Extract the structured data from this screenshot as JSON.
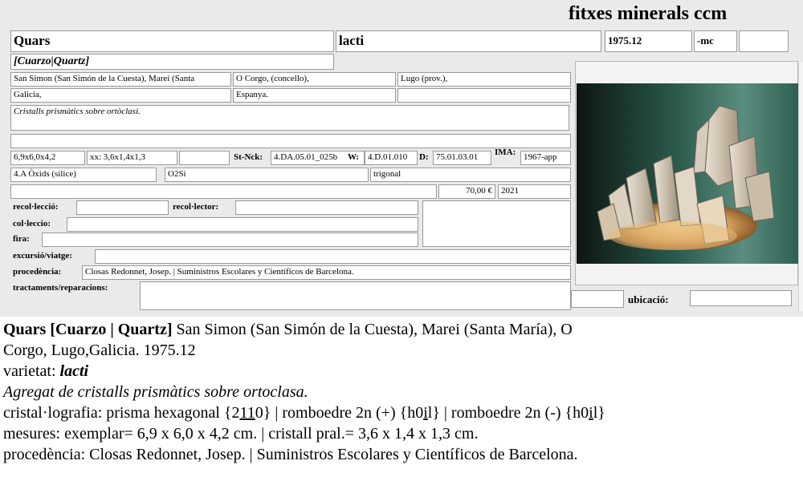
{
  "card": {
    "title": "fitxes minerals ccm",
    "name": "Quars",
    "variety": "lacti",
    "date": "1975.12",
    "suffix": "-mc",
    "synonyms": "[Cuarzo|Quartz]",
    "loc1": "San Simon (San Simón de la Cuesta), Marei (Santa",
    "loc2": "O Corgo, (concello),",
    "loc3": "Lugo (prov.),",
    "loc4": "Galicia,",
    "loc5": "Espanya.",
    "description": "Cristalls prismàtics sobre ortòclasi.",
    "size": "6,9x6,0x4,2",
    "crystal_size": "xx: 3,6x1,4x1,3",
    "stnck_label": "St-Nck:",
    "stnck": "4.DA.05.01_025b",
    "w_label": "W:",
    "w": "4.D.01.010",
    "d_label": "D:",
    "d": "75.01.03.01",
    "ima_label": "IMA:",
    "ima": "1967-app",
    "class": "4.A Òxids (silice)",
    "formula": "O2Si",
    "system": "trigonal",
    "price": "70,00 €",
    "year": "2021",
    "recoleccio_label": "recol·lecció:",
    "recolector_label": "recol·lector:",
    "colleccio_label": "col·leccio:",
    "fira_label": "fira:",
    "excursio_label": "excursió/viatge:",
    "procedencia_label": "procedència:",
    "procedencia": "Closas Redonnet, Josep. | Suministros Escolares y Científicos de Barcelona.",
    "tractaments_label": "tractaments/reparacions:",
    "ubicacio_label": "ubicació:"
  },
  "caption": {
    "line1_bold": "Quars [Cuarzo | Quartz]",
    "line1_rest": " San Simon (San Simón de la Cuesta), Marei (Santa María), O",
    "line2": "Corgo, Lugo,Galicia. 1975.12",
    "line3_label": "varietat: ",
    "line3_value": "lacti",
    "line4": "Agregat de cristalls prismàtics sobre ortoclasa.",
    "line5_a": "cristal·lografia: prisma hexagonal {2",
    "line5_u": "11",
    "line5_b": "0} | romboedre 2n (+) {h0",
    "line5_u2": "i",
    "line5_c": "l} | romboedre 2n (-) {h0",
    "line5_u3": "i",
    "line5_d": "l}",
    "line6": "mesures: exemplar= 6,9 x 6,0 x 4,2 cm. | cristall pral.= 3,6 x 1,4 x 1,3 cm.",
    "line7": "procedència: Closas Redonnet, Josep. | Suministros Escolares y Científicos de Barcelona."
  },
  "colors": {
    "card_bg": "#eaeaea",
    "field_bg": "#ffffff",
    "field_border": "#9a9a9a",
    "photo_bg": "#0e2a24"
  }
}
